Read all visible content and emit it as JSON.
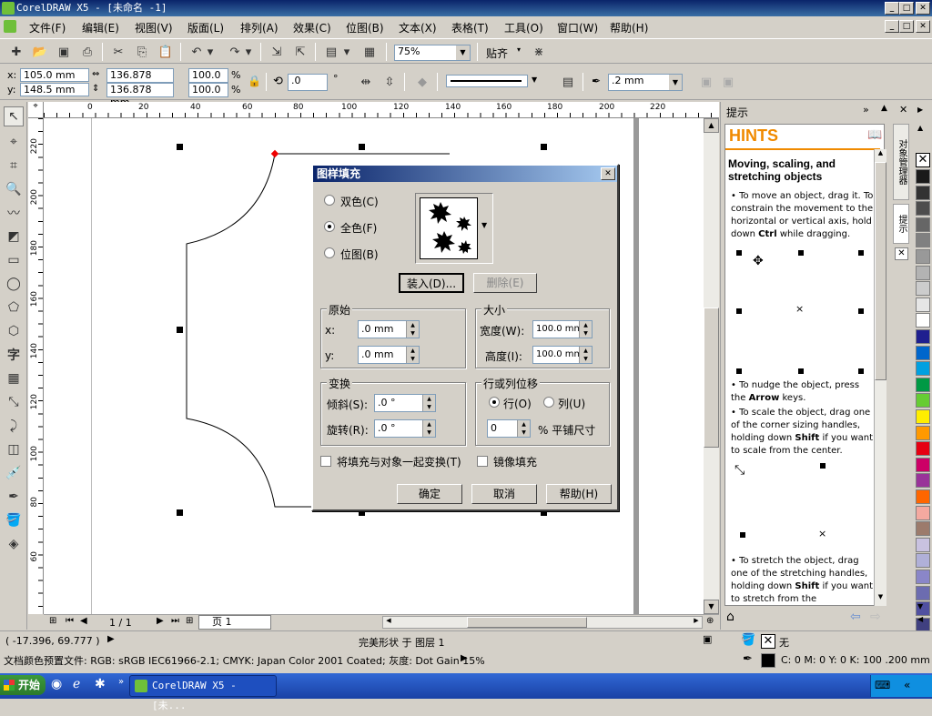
{
  "app": {
    "title": "CorelDRAW X5 - [未命名 -1]"
  },
  "menu": [
    "文件(F)",
    "编辑(E)",
    "视图(V)",
    "版面(L)",
    "排列(A)",
    "效果(C)",
    "位图(B)",
    "文本(X)",
    "表格(T)",
    "工具(O)",
    "窗口(W)",
    "帮助(H)"
  ],
  "toolbar": {
    "zoom": "75%",
    "snap": "贴齐"
  },
  "propbar": {
    "x": "x: 105.0 mm",
    "y": "y: 148.5 mm",
    "width": "136.878 mm",
    "height": "136.878 mm",
    "scale_w": "100.0",
    "scale_h": "100.0",
    "pct": "%",
    "rotation": ".0",
    "deg": "°",
    "outline_width": ".2 mm"
  },
  "rulers": {
    "h_ticks": [
      "0",
      "20",
      "40",
      "60",
      "80",
      "100",
      "120",
      "140",
      "160",
      "180",
      "200",
      "220"
    ],
    "v_ticks": [
      "220",
      "200",
      "180",
      "160",
      "140",
      "120",
      "100",
      "80",
      "60"
    ]
  },
  "dialog": {
    "title": "图样填充",
    "radio_two_color": "双色(C)",
    "radio_full_color": "全色(F)",
    "radio_bitmap": "位图(B)",
    "load_btn": "装入(D)...",
    "delete_btn": "删除(E)",
    "origin_group": "原始",
    "origin_x_label": "x:",
    "origin_x": ".0 mm",
    "origin_y_label": "y:",
    "origin_y": ".0 mm",
    "size_group": "大小",
    "width_label": "宽度(W):",
    "width": "100.0 mm",
    "height_label": "高度(I):",
    "height": "100.0 mm",
    "transform_group": "变换",
    "skew_label": "倾斜(S):",
    "skew": ".0 °",
    "rotate_label": "旋转(R):",
    "rotate": ".0 °",
    "offset_group": "行或列位移",
    "row_label": "行(O)",
    "col_label": "列(U)",
    "offset_value": "0",
    "offset_unit": "% 平铺尺寸",
    "chk_transform": "将填充与对象一起变换(T)",
    "chk_mirror": "镜像填充",
    "ok": "确定",
    "cancel": "取消",
    "help": "帮助(H)"
  },
  "hints": {
    "panel_title": "提示",
    "header": "HINTS",
    "heading": "Moving, scaling, and stretching objects",
    "p1a": "To move an object, drag it. To constrain the movement to the horizontal or vertical axis, hold down ",
    "p1b": "Ctrl",
    "p1c": " while dragging.",
    "p2a": "To nudge the object, press the ",
    "p2b": "Arrow",
    "p2c": " keys.",
    "p3a": "To scale the object, drag one of the corner sizing handles, holding down ",
    "p3b": "Shift",
    "p3c": " if you want to scale from the center.",
    "p4a": "To stretch the object, drag one of the stretching handles, holding down ",
    "p4b": "Shift",
    "p4c": " if you want to stretch from the"
  },
  "side_tabs": {
    "object_manager": "对象管理器",
    "hints": "提示"
  },
  "pages": {
    "counter": "1 / 1",
    "tab": "页 1"
  },
  "status": {
    "coords": "( -17.396, 69.777 )",
    "object": "完美形状 于 图层 1",
    "profile": "文档颜色预置文件: RGB: sRGB IEC61966-2.1; CMYK: Japan Color 2001 Coated; 灰度: Dot Gain 15%",
    "fill": "无",
    "outline": "C: 0 M: 0 Y: 0 K: 100  .200 mm"
  },
  "taskbar": {
    "start": "开始",
    "task": "CorelDRAW X5 - [未..."
  },
  "palette": [
    "#ffffff",
    "#000000",
    "#1a1a1a",
    "#333333",
    "#4d4d4d",
    "#666666",
    "#808080",
    "#999999",
    "#b3b3b3",
    "#cccccc",
    "#e6e6e6",
    "#ffffff",
    "#1f1f8f",
    "#0066cc",
    "#00a0e0",
    "#009944",
    "#66cc33",
    "#ffee00",
    "#ff9900",
    "#e60012",
    "#cc0066",
    "#993399",
    "#ff6600",
    "#f4a9a0",
    "#9c7b6c",
    "#c9c2e0",
    "#b0b0d8",
    "#8a86c8",
    "#6c6cb0",
    "#5050a0",
    "#404080"
  ]
}
